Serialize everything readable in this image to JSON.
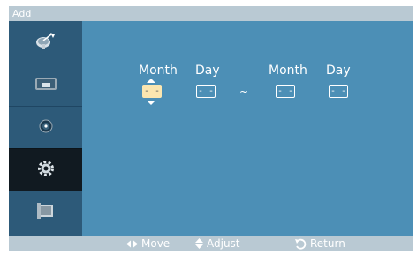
{
  "title": "Add",
  "sidebar": {
    "items": [
      {
        "icon": "satellite-dish-icon",
        "selected": false
      },
      {
        "icon": "picture-icon",
        "selected": false
      },
      {
        "icon": "sound-icon",
        "selected": false
      },
      {
        "icon": "gear-icon",
        "selected": true
      },
      {
        "icon": "input-source-icon",
        "selected": false
      }
    ]
  },
  "date_range": {
    "start": {
      "month_label": "Month",
      "day_label": "Day",
      "month_value": "- -",
      "day_value": "- -"
    },
    "separator": "~",
    "end": {
      "month_label": "Month",
      "day_label": "Day",
      "month_value": "- -",
      "day_value": "- -"
    },
    "active_field": "start.month"
  },
  "footer": {
    "move": {
      "icon": "left-right-arrow-icon",
      "label": "Move"
    },
    "adjust": {
      "icon": "up-down-arrow-icon",
      "label": "Adjust"
    },
    "return": {
      "icon": "return-arrow-icon",
      "label": "Return"
    }
  },
  "colors": {
    "panel": "#4c8fb6",
    "sidebar": "#2d5a79",
    "sidebar_selected": "#111a21",
    "bars": "#b9c9d3",
    "active_field": "#fbe6b0"
  }
}
